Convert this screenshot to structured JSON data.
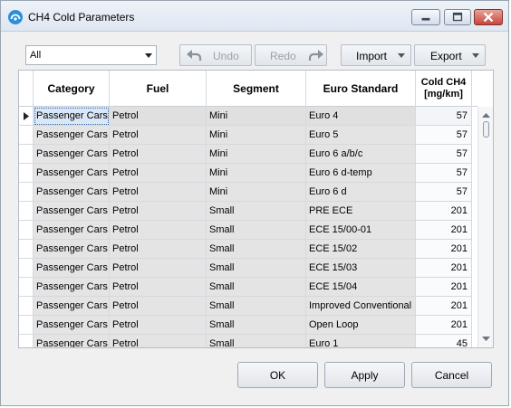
{
  "window": {
    "title": "CH4 Cold Parameters"
  },
  "toolbar": {
    "filter_value": "All",
    "undo_label": "Undo",
    "redo_label": "Redo",
    "import_label": "Import",
    "export_label": "Export"
  },
  "grid": {
    "columns": [
      "Category",
      "Fuel",
      "Segment",
      "Euro Standard",
      "Cold CH4\n[mg/km]"
    ],
    "rows": [
      [
        "Passenger Cars",
        "Petrol",
        "Mini",
        "Euro 4",
        "57"
      ],
      [
        "Passenger Cars",
        "Petrol",
        "Mini",
        "Euro 5",
        "57"
      ],
      [
        "Passenger Cars",
        "Petrol",
        "Mini",
        "Euro 6 a/b/c",
        "57"
      ],
      [
        "Passenger Cars",
        "Petrol",
        "Mini",
        "Euro 6 d-temp",
        "57"
      ],
      [
        "Passenger Cars",
        "Petrol",
        "Mini",
        "Euro 6 d",
        "57"
      ],
      [
        "Passenger Cars",
        "Petrol",
        "Small",
        "PRE ECE",
        "201"
      ],
      [
        "Passenger Cars",
        "Petrol",
        "Small",
        "ECE 15/00-01",
        "201"
      ],
      [
        "Passenger Cars",
        "Petrol",
        "Small",
        "ECE 15/02",
        "201"
      ],
      [
        "Passenger Cars",
        "Petrol",
        "Small",
        "ECE 15/03",
        "201"
      ],
      [
        "Passenger Cars",
        "Petrol",
        "Small",
        "ECE 15/04",
        "201"
      ],
      [
        "Passenger Cars",
        "Petrol",
        "Small",
        "Improved Conventional",
        "201"
      ],
      [
        "Passenger Cars",
        "Petrol",
        "Small",
        "Open Loop",
        "201"
      ],
      [
        "Passenger Cars",
        "Petrol",
        "Small",
        "Euro 1",
        "45"
      ]
    ]
  },
  "footer": {
    "ok_label": "OK",
    "apply_label": "Apply",
    "cancel_label": "Cancel"
  }
}
